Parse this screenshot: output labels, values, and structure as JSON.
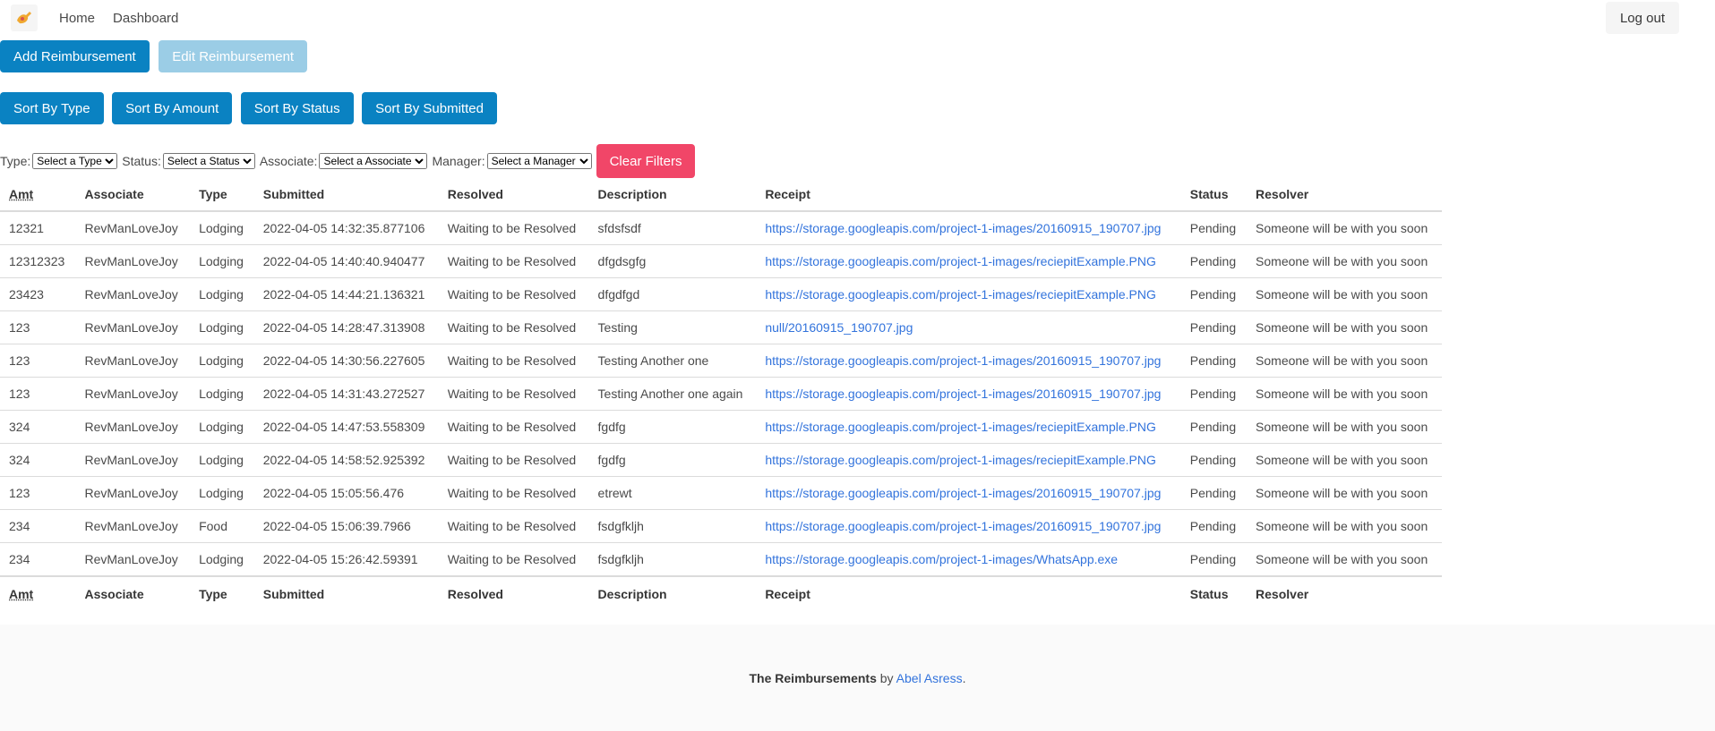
{
  "nav": {
    "links": [
      "Home",
      "Dashboard"
    ],
    "logout": "Log out"
  },
  "actions": {
    "add": "Add Reimbursement",
    "edit": "Edit Reimbursement"
  },
  "sort": [
    "Sort By Type",
    "Sort By Amount",
    "Sort By Status",
    "Sort By Submitted"
  ],
  "filters": {
    "type_label": "Type:",
    "type_value": "Select a Type",
    "status_label": "Status:",
    "status_value": "Select a Status",
    "associate_label": "Associate:",
    "associate_value": "Select a Associate",
    "manager_label": "Manager:",
    "manager_value": "Select a Manager",
    "clear": "Clear Filters"
  },
  "table": {
    "columns": [
      "Amt",
      "Associate",
      "Type",
      "Submitted",
      "Resolved",
      "Description",
      "Receipt",
      "Status",
      "Resolver"
    ],
    "rows": [
      [
        "12321",
        "RevManLoveJoy",
        "Lodging",
        "2022-04-05 14:32:35.877106",
        "Waiting to be Resolved",
        "sfdsfsdf",
        "https://storage.googleapis.com/project-1-images/20160915_190707.jpg",
        "Pending",
        "Someone will be with you soon"
      ],
      [
        "12312323",
        "RevManLoveJoy",
        "Lodging",
        "2022-04-05 14:40:40.940477",
        "Waiting to be Resolved",
        "dfgdsgfg",
        "https://storage.googleapis.com/project-1-images/reciepitExample.PNG",
        "Pending",
        "Someone will be with you soon"
      ],
      [
        "23423",
        "RevManLoveJoy",
        "Lodging",
        "2022-04-05 14:44:21.136321",
        "Waiting to be Resolved",
        "dfgdfgd",
        "https://storage.googleapis.com/project-1-images/reciepitExample.PNG",
        "Pending",
        "Someone will be with you soon"
      ],
      [
        "123",
        "RevManLoveJoy",
        "Lodging",
        "2022-04-05 14:28:47.313908",
        "Waiting to be Resolved",
        "Testing",
        "null/20160915_190707.jpg",
        "Pending",
        "Someone will be with you soon"
      ],
      [
        "123",
        "RevManLoveJoy",
        "Lodging",
        "2022-04-05 14:30:56.227605",
        "Waiting to be Resolved",
        "Testing Another one",
        "https://storage.googleapis.com/project-1-images/20160915_190707.jpg",
        "Pending",
        "Someone will be with you soon"
      ],
      [
        "123",
        "RevManLoveJoy",
        "Lodging",
        "2022-04-05 14:31:43.272527",
        "Waiting to be Resolved",
        "Testing Another one again",
        "https://storage.googleapis.com/project-1-images/20160915_190707.jpg",
        "Pending",
        "Someone will be with you soon"
      ],
      [
        "324",
        "RevManLoveJoy",
        "Lodging",
        "2022-04-05 14:47:53.558309",
        "Waiting to be Resolved",
        "fgdfg",
        "https://storage.googleapis.com/project-1-images/reciepitExample.PNG",
        "Pending",
        "Someone will be with you soon"
      ],
      [
        "324",
        "RevManLoveJoy",
        "Lodging",
        "2022-04-05 14:58:52.925392",
        "Waiting to be Resolved",
        "fgdfg",
        "https://storage.googleapis.com/project-1-images/reciepitExample.PNG",
        "Pending",
        "Someone will be with you soon"
      ],
      [
        "123",
        "RevManLoveJoy",
        "Lodging",
        "2022-04-05 15:05:56.476",
        "Waiting to be Resolved",
        "etrewt",
        "https://storage.googleapis.com/project-1-images/20160915_190707.jpg",
        "Pending",
        "Someone will be with you soon"
      ],
      [
        "234",
        "RevManLoveJoy",
        "Food",
        "2022-04-05 15:06:39.7966",
        "Waiting to be Resolved",
        "fsdgfkljh",
        "https://storage.googleapis.com/project-1-images/20160915_190707.jpg",
        "Pending",
        "Someone will be with you soon"
      ],
      [
        "234",
        "RevManLoveJoy",
        "Lodging",
        "2022-04-05 15:26:42.59391",
        "Waiting to be Resolved",
        "fsdgfkljh",
        "https://storage.googleapis.com/project-1-images/WhatsApp.exe",
        "Pending",
        "Someone will be with you soon"
      ]
    ]
  },
  "footer": {
    "brand": "The Reimbursements",
    "by": " by ",
    "author": "Abel Asress",
    "period": "."
  },
  "colors": {
    "primary": "#0a82c2",
    "primary_disabled": "#9bcde6",
    "danger": "#f14668",
    "link": "#3273dc"
  }
}
